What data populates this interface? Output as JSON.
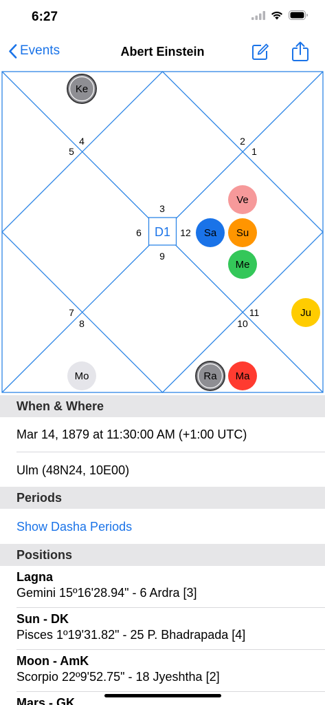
{
  "status_bar": {
    "time": "6:27",
    "icons": [
      "signal-icon",
      "wifi-icon",
      "battery-icon"
    ]
  },
  "nav": {
    "back_label": "Events",
    "title": "Abert Einstein",
    "icons": [
      "chevron-left-icon",
      "edit-icon",
      "share-icon"
    ]
  },
  "chart": {
    "center_label": "D1",
    "houses": [
      "1",
      "2",
      "3",
      "4",
      "5",
      "6",
      "7",
      "8",
      "9",
      "10",
      "11",
      "12"
    ],
    "planets": [
      {
        "abbr": "Ke",
        "color": "#8e8e93"
      },
      {
        "abbr": "Ve",
        "color": "#f6999a"
      },
      {
        "abbr": "Sa",
        "color": "#1a73e8"
      },
      {
        "abbr": "Su",
        "color": "#ff9500"
      },
      {
        "abbr": "Me",
        "color": "#34c759"
      },
      {
        "abbr": "Ju",
        "color": "#ffcc00"
      },
      {
        "abbr": "Mo",
        "color": "#e5e5ea"
      },
      {
        "abbr": "Ra",
        "color": "#8e8e93"
      },
      {
        "abbr": "Ma",
        "color": "#ff3b30"
      }
    ],
    "line_color": "#2e86e6"
  },
  "when_where": {
    "header": "When & Where",
    "datetime": "Mar 14, 1879 at 11:30:00 AM (+1:00 UTC)",
    "place": "Ulm (48N24, 10E00)"
  },
  "periods": {
    "header": "Periods",
    "link": "Show Dasha Periods"
  },
  "positions": {
    "header": "Positions",
    "items": [
      {
        "title": "Lagna",
        "detail": "Gemini 15º16'28.94\" - 6 Ardra [3]"
      },
      {
        "title": "Sun - DK",
        "detail": "Pisces 1º19'31.82\" - 25 P. Bhadrapada [4]"
      },
      {
        "title": "Moon - AmK",
        "detail": "Scorpio 22º9'52.75\" - 18 Jyeshtha [2]"
      },
      {
        "title": "Mars - GK",
        "detail": ""
      }
    ]
  }
}
